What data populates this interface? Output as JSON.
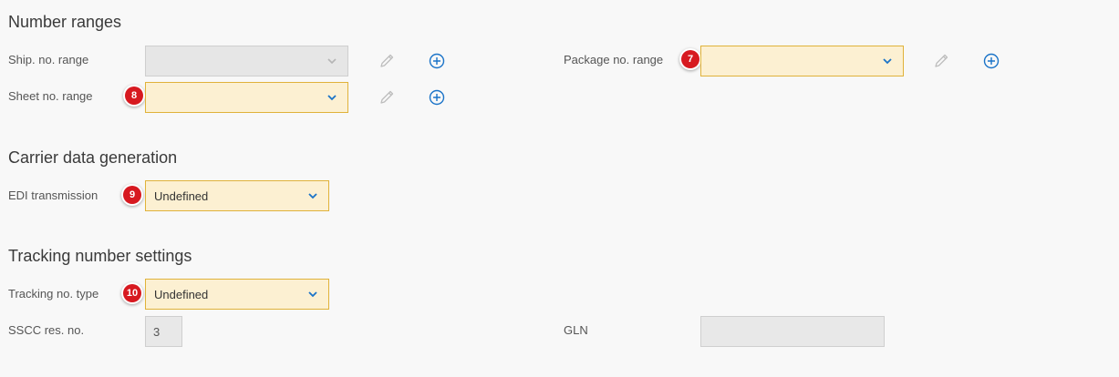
{
  "sections": {
    "number_ranges": {
      "title": "Number ranges",
      "ship_label": "Ship. no. range",
      "ship_value": "",
      "sheet_label": "Sheet no. range",
      "sheet_value": "",
      "package_label": "Package no. range",
      "package_value": ""
    },
    "carrier": {
      "title": "Carrier data generation",
      "edi_label": "EDI transmission",
      "edi_value": "Undefined"
    },
    "tracking": {
      "title": "Tracking number settings",
      "type_label": "Tracking no. type",
      "type_value": "Undefined",
      "sscc_label": "SSCC res. no.",
      "sscc_value": "3",
      "gln_label": "GLN",
      "gln_value": ""
    }
  },
  "badges": {
    "b7": "7",
    "b8": "8",
    "b9": "9",
    "b10": "10"
  },
  "icons": {
    "edit": "pencil-icon",
    "add": "plus-circle-icon",
    "dropdown": "chevron-down-icon"
  },
  "colors": {
    "accent": "#1a73c8",
    "badge": "#d71920",
    "field_highlight": "#fcf0d2",
    "field_border": "#e0b23a"
  }
}
